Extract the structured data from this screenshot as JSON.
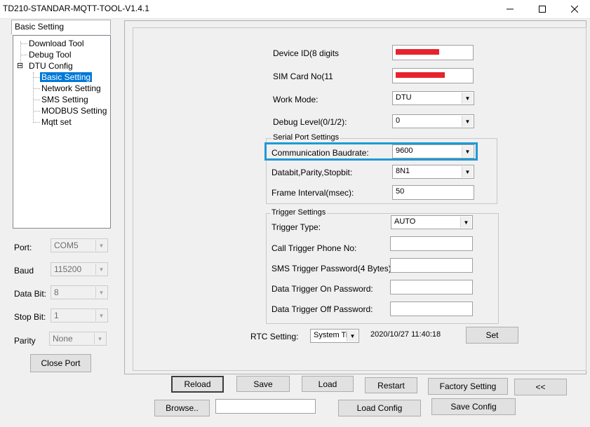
{
  "window": {
    "title": "TD210-STANDAR-MQTT-TOOL-V1.4.1"
  },
  "left": {
    "tab_label": "Basic Setting",
    "tree": {
      "download_tool": "Download Tool",
      "debug_tool": "Debug Tool",
      "dtu_config": "DTU Config",
      "basic_setting": "Basic Setting",
      "network_setting": "Network Setting",
      "sms_setting": "SMS Setting",
      "modbus_setting": "MODBUS Setting",
      "mqtt_set": "Mqtt set",
      "expander": "⊟"
    },
    "port_label": "Port:",
    "port_value": "COM5",
    "baud_label": "Baud",
    "baud_value": "115200",
    "databit_label": "Data Bit:",
    "databit_value": "8",
    "stopbit_label": "Stop Bit:",
    "stopbit_value": "1",
    "parity_label": "Parity",
    "parity_value": "None",
    "close_port": "Close Port"
  },
  "form": {
    "device_id_label": "Device ID(8 digits",
    "sim_card_label": "SIM Card No(11",
    "work_mode_label": "Work Mode:",
    "work_mode_value": "DTU",
    "debug_level_label": "Debug Level(0/1/2):",
    "debug_level_value": "0",
    "serial_group": "Serial Port Settings",
    "baudrate_label": "Communication Baudrate:",
    "baudrate_value": "9600",
    "databit_label": "Databit,Parity,Stopbit:",
    "databit_value": "8N1",
    "frame_label": "Frame Interval(msec):",
    "frame_value": "50",
    "trigger_group": "Trigger Settings",
    "trigger_type_label": "Trigger Type:",
    "trigger_type_value": "AUTO",
    "call_trigger_label": "Call Trigger Phone No:",
    "sms_trigger_label": "SMS Trigger Password(4 Bytes):",
    "data_on_label": "Data Trigger On Password:",
    "data_off_label": "Data Trigger Off Password:",
    "rtc_label": "RTC Setting:",
    "rtc_value": "System Ti",
    "rtc_time": "2020/10/27 11:40:18",
    "set_button": "Set"
  },
  "buttons": {
    "reload": "Reload",
    "save": "Save",
    "load": "Load",
    "restart": "Restart",
    "factory": "Factory Setting",
    "collapse": "<<",
    "browse": "Browse..",
    "load_config": "Load Config",
    "save_config": "Save Config"
  },
  "colors": {
    "highlight": "#1e9ad6",
    "redaction": "#e8222c",
    "selection": "#0078d7"
  },
  "icons": {
    "minimize": "minimize-icon",
    "maximize": "maximize-icon",
    "close": "close-icon",
    "dropdown": "chevron-down-icon"
  }
}
